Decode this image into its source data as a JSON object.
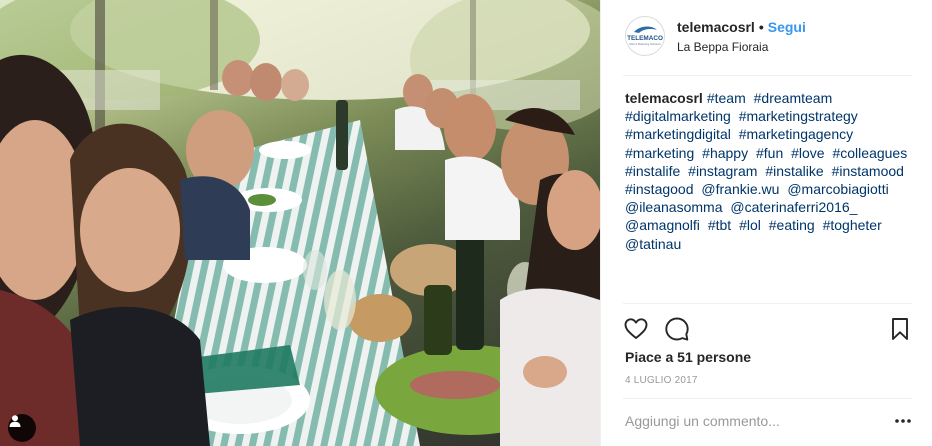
{
  "post": {
    "username": "telemacosrl",
    "separator": "•",
    "follow_label": "Segui",
    "location": "La Beppa Fioraia",
    "avatar_text": "TELEMACO",
    "avatar_subtext": "Web & Marketing Solutions"
  },
  "caption": {
    "author": "telemacosrl",
    "tags": [
      "#team",
      "#dreamteam",
      "#digitalmarketing",
      "#marketingstrategy",
      "#marketingdigital",
      "#marketingagency",
      "#marketing",
      "#happy",
      "#fun",
      "#love",
      "#colleagues",
      "#instalife",
      "#instagram",
      "#instalike",
      "#instamood",
      "#instagood",
      "@frankie.wu",
      "@marcobiagiotti",
      "@ileanasomma",
      "@caterinaferri2016_",
      "@amagnolfi",
      "#tbt",
      "#lol",
      "#eating",
      "#togheter",
      "@tatinau"
    ]
  },
  "engagement": {
    "likes_text": "Piace a 51 persone",
    "date": "4 LUGLIO 2017"
  },
  "comment": {
    "placeholder": "Aggiungi un commento..."
  },
  "icons": {
    "like": "heart-icon",
    "comment": "comment-bubble-icon",
    "save": "bookmark-icon",
    "more": "more-dots-icon",
    "user_tags": "user-tag-icon"
  },
  "colors": {
    "link": "#003569",
    "follow": "#3897f0",
    "muted": "#999999",
    "border": "#efefef"
  }
}
